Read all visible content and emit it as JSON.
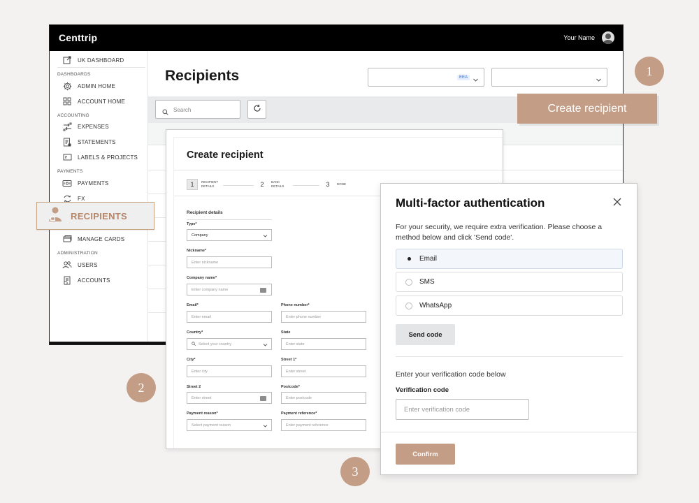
{
  "app": {
    "logo": "Centtrip",
    "user_name": "Your Name"
  },
  "sidebar": {
    "top_item": "UK DASHBOARD",
    "sections": {
      "dashboards": "DASHBOARDS",
      "accounting": "ACCOUNTING",
      "payments": "PAYMENTS",
      "administration": "ADMINISTRATION"
    },
    "items": {
      "admin_home": "ADMIN HOME",
      "account_home": "ACCOUNT HOME",
      "expenses": "EXPENSES",
      "statements": "STATEMENTS",
      "labels_projects": "LABELS & PROJECTS",
      "payments": "PAYMENTS",
      "fx": "FX",
      "recipients": "RECIPIENTS",
      "manage_cards": "MANAGE CARDS",
      "users": "USERS",
      "accounts": "ACCOUNTS"
    }
  },
  "main": {
    "title": "Recipients",
    "region_badge": "EEA",
    "search_placeholder": "Search"
  },
  "create_button_label": "Create recipient",
  "bubbles": {
    "one": "1",
    "two": "2",
    "three": "3"
  },
  "create_panel": {
    "title": "Create recipient",
    "steps": [
      {
        "num": "1",
        "label": "RECIPIENT DETAILS"
      },
      {
        "num": "2",
        "label": "BANK DETAILS"
      },
      {
        "num": "3",
        "label": "DONE"
      }
    ],
    "section_label": "Recipient details",
    "fields": {
      "type": {
        "label": "Type*",
        "value": "Company"
      },
      "nickname": {
        "label": "Nickname*",
        "placeholder": "Enter nickname"
      },
      "company_name": {
        "label": "Company name*",
        "placeholder": "Enter company name"
      },
      "email": {
        "label": "Email*",
        "placeholder": "Enter email"
      },
      "phone": {
        "label": "Phone number*",
        "placeholder": "Enter phone number"
      },
      "country": {
        "label": "Country*",
        "placeholder": "Select your country"
      },
      "state": {
        "label": "State",
        "placeholder": "Enter state"
      },
      "city": {
        "label": "City*",
        "placeholder": "Enter city"
      },
      "street1": {
        "label": "Street 1*",
        "placeholder": "Enter street"
      },
      "street2": {
        "label": "Street 2",
        "placeholder": "Enter street"
      },
      "postcode": {
        "label": "Postcode*",
        "placeholder": "Enter postcode"
      },
      "payment_reason": {
        "label": "Payment reason*",
        "placeholder": "Select payment reason"
      },
      "payment_reference": {
        "label": "Payment reference*",
        "placeholder": "Enter payment reference"
      }
    }
  },
  "mfa": {
    "title": "Multi-factor authentication",
    "description": "For your security, we require extra verification. Please choose a method below and click 'Send code'.",
    "options": [
      "Email",
      "SMS",
      "WhatsApp"
    ],
    "selected": "Email",
    "send_code": "Send code",
    "subtitle": "Enter your verification code below",
    "code_label": "Verification code",
    "code_placeholder": "Enter verification code",
    "confirm": "Confirm"
  },
  "colors": {
    "accent": "#c39d85",
    "topbar": "#000000",
    "badge_blue": "#3a6fd8"
  }
}
